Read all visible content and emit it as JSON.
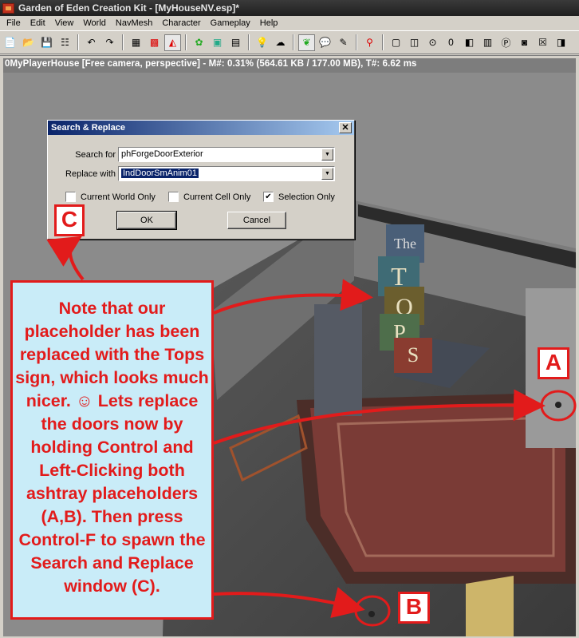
{
  "window": {
    "title": "Garden of Eden Creation Kit - [MyHouseNV.esp]*"
  },
  "menu": [
    "File",
    "Edit",
    "View",
    "World",
    "NavMesh",
    "Character",
    "Gameplay",
    "Help"
  ],
  "toolbar": {
    "icons": [
      "new-icon",
      "open-icon",
      "save-icon",
      "preferences-icon",
      "undo-icon",
      "redo-icon",
      "grid-icon",
      "snap-icon",
      "angle-snap-icon",
      "landscape-icon",
      "terrain-icon",
      "havok-icon",
      "lighting-icon",
      "sky-icon",
      "leaf-icon",
      "speech-icon",
      "pencil-icon",
      "markers-icon",
      "box-icon",
      "box2-icon",
      "circle-icon",
      "number-icon",
      "portal-icon",
      "wall-icon",
      "p-icon",
      "o-icon",
      "x-icon",
      "light-icon"
    ]
  },
  "viewport": {
    "caption": "0MyPlayerHouse [Free camera, perspective] - M#: 0.31% (564.61 KB / 177.00 MB), T#: 6.62 ms"
  },
  "dialog": {
    "title": "Search & Replace",
    "close": "✕",
    "search_label": "Search for",
    "search_value": "phForgeDoorExterior",
    "replace_label": "Replace with",
    "replace_value": "IndDoorSmAnim01",
    "check_world": "Current World Only",
    "check_cell": "Current Cell Only",
    "check_selection": "Selection Only",
    "ok": "OK",
    "cancel": "Cancel"
  },
  "annotation": {
    "note": "Note that our placeholder has been replaced with the Tops sign, which looks much nicer. ☺ Lets replace the doors now by holding Control and Left-Clicking both ashtray placeholders (A,B). Then press Control-F to spawn the Search and Replace window (C).",
    "label_a": "A",
    "label_b": "B",
    "label_c": "C"
  },
  "scene": {
    "sign_letters": [
      "The",
      "T",
      "O",
      "P",
      "S"
    ]
  },
  "colors": {
    "annotation_red": "#e21b1b",
    "note_bg": "#c9ecf8"
  }
}
